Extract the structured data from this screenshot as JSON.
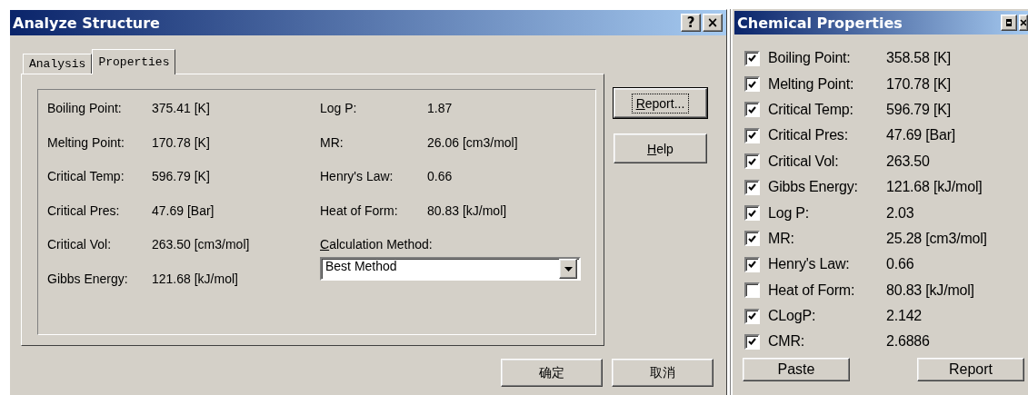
{
  "dialog": {
    "title": "Analyze Structure",
    "title_buttons": [
      "?",
      "×"
    ],
    "tabs": [
      {
        "label": "Analysis",
        "selected": false
      },
      {
        "label": "Properties",
        "selected": true
      }
    ],
    "properties_left": [
      {
        "label": "Boiling Point:",
        "value": "375.41 [K]"
      },
      {
        "label": "Melting Point:",
        "value": "170.78 [K]"
      },
      {
        "label": "Critical Temp:",
        "value": "596.79 [K]"
      },
      {
        "label": "Critical Pres:",
        "value": "47.69 [Bar]"
      },
      {
        "label": "Critical Vol:",
        "value": "263.50 [cm3/mol]"
      },
      {
        "label": "Gibbs Energy:",
        "value": "121.68 [kJ/mol]"
      }
    ],
    "properties_right": [
      {
        "label": "Log P:",
        "value": "1.87"
      },
      {
        "label": "MR:",
        "value": "26.06 [cm3/mol]"
      },
      {
        "label": "Henry's Law:",
        "value": "0.66"
      },
      {
        "label": "Heat of Form:",
        "value": "80.83 [kJ/mol]"
      }
    ],
    "calculation_method": {
      "label": "Calculation Method:",
      "underline_first": true,
      "value": "Best Method"
    },
    "side_buttons": [
      {
        "label": "Report...",
        "underline_first": true,
        "focused": true
      },
      {
        "label": "Help",
        "underline_first": true,
        "focused": false
      }
    ],
    "footer_buttons": [
      "确定",
      "取消"
    ]
  },
  "panel": {
    "title": "Chemical Properties",
    "properties": [
      {
        "label": "Boiling Point:",
        "value": "358.58 [K]",
        "checked": true
      },
      {
        "label": "Melting Point:",
        "value": "170.78 [K]",
        "checked": true
      },
      {
        "label": "Critical Temp:",
        "value": "596.79 [K]",
        "checked": true
      },
      {
        "label": "Critical Pres:",
        "value": "47.69 [Bar]",
        "checked": true
      },
      {
        "label": "Critical Vol:",
        "value": "263.50",
        "checked": true
      },
      {
        "label": "Gibbs Energy:",
        "value": "121.68 [kJ/mol]",
        "checked": true
      },
      {
        "label": "Log P:",
        "value": "2.03",
        "checked": true
      },
      {
        "label": "MR:",
        "value": "25.28 [cm3/mol]",
        "checked": true
      },
      {
        "label": "Henry's Law:",
        "value": "0.66",
        "checked": true
      },
      {
        "label": "Heat of Form:",
        "value": "80.83 [kJ/mol]",
        "checked": false
      },
      {
        "label": "CLogP:",
        "value": "2.142",
        "checked": true
      },
      {
        "label": "CMR:",
        "value": "2.6886",
        "checked": true
      }
    ],
    "buttons": [
      "Paste",
      "Report"
    ]
  }
}
